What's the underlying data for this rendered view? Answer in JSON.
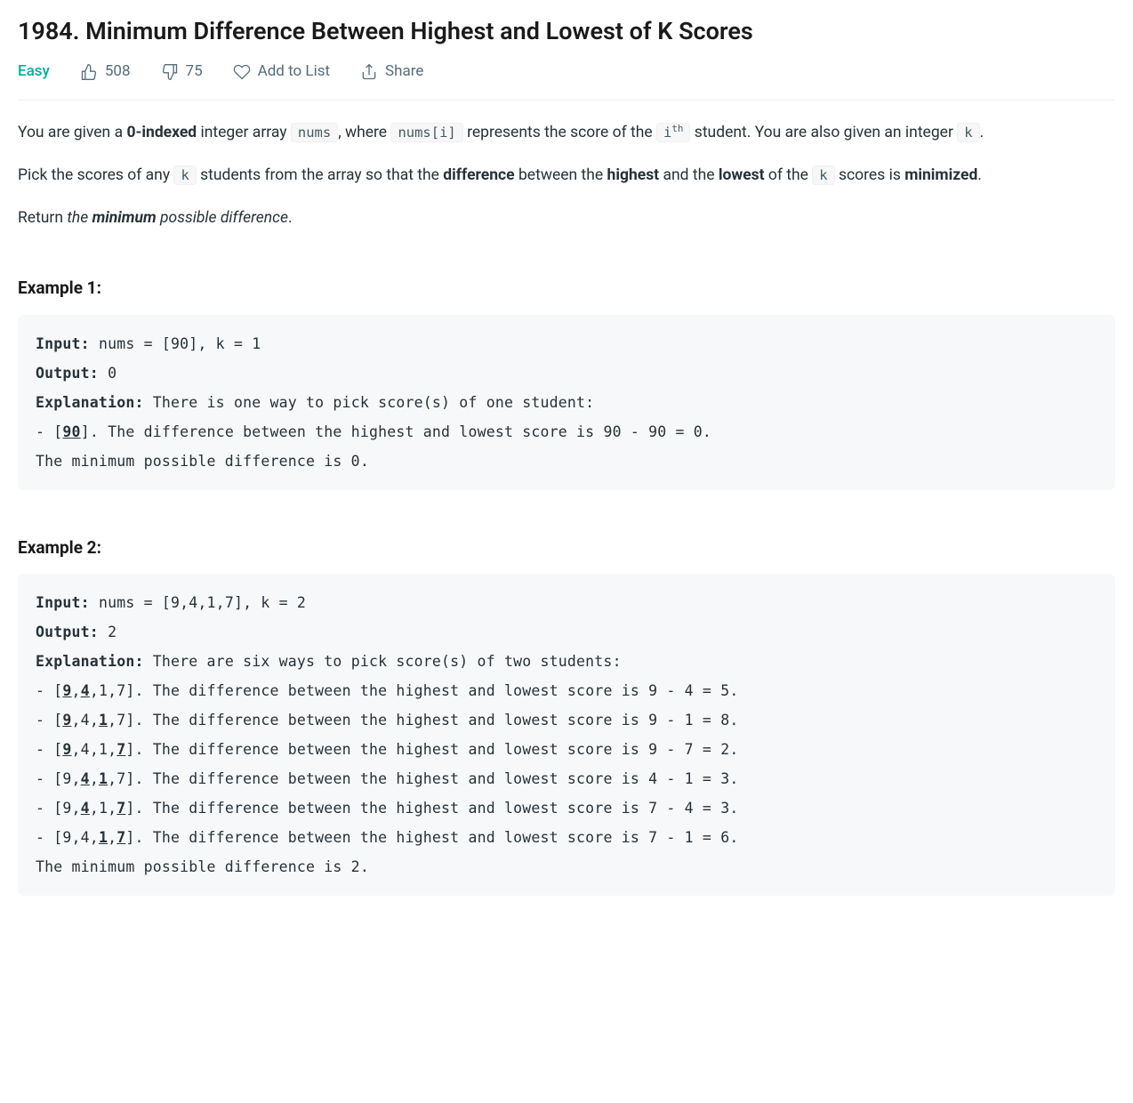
{
  "title": "1984. Minimum Difference Between Highest and Lowest of K Scores",
  "meta": {
    "difficulty": "Easy",
    "likes": "508",
    "dislikes": "75",
    "add_to_list": "Add to List",
    "share": "Share"
  },
  "desc": {
    "p1_a": "You are given a ",
    "p1_b": "0-indexed",
    "p1_c": " integer array ",
    "p1_code1": "nums",
    "p1_d": ", where ",
    "p1_code2": "nums[i]",
    "p1_e": " represents the score of the ",
    "p1_code3_base": "i",
    "p1_code3_sup": "th",
    "p1_f": " student. You are also given an integer ",
    "p1_code4": "k",
    "p1_g": ".",
    "p2_a": "Pick the scores of any ",
    "p2_code1": "k",
    "p2_b": " students from the array so that the ",
    "p2_c": "difference",
    "p2_d": " between the ",
    "p2_e": "highest",
    "p2_f": " and the ",
    "p2_g": "lowest",
    "p2_h": " of the ",
    "p2_code2": "k",
    "p2_i": " scores is ",
    "p2_j": "minimized",
    "p2_k": ".",
    "p3_a": "Return ",
    "p3_b": "the ",
    "p3_c": "minimum",
    "p3_d": " possible difference",
    "p3_e": "."
  },
  "example1_title": "Example 1:",
  "example1": {
    "input_label": "Input:",
    "input_val": " nums = [90], k = 1",
    "output_label": "Output:",
    "output_val": " 0",
    "expl_label": "Explanation:",
    "expl_intro": " There is one way to pick score(s) of one student:",
    "line1_a": "- [",
    "line1_u": "90",
    "line1_b": "]. The difference between the highest and lowest score is 90 - 90 = 0.",
    "final": "The minimum possible difference is 0."
  },
  "example2_title": "Example 2:",
  "example2": {
    "input_label": "Input:",
    "input_val": " nums = [9,4,1,7], k = 2",
    "output_label": "Output:",
    "output_val": " 2",
    "expl_label": "Explanation:",
    "expl_intro": " There are six ways to pick score(s) of two students:",
    "l1_a": "- [",
    "l1_u1": "9",
    "l1_b": ",",
    "l1_u2": "4",
    "l1_c": ",1,7]. The difference between the highest and lowest score is 9 - 4 = 5.",
    "l2_a": "- [",
    "l2_u1": "9",
    "l2_b": ",4,",
    "l2_u2": "1",
    "l2_c": ",7]. The difference between the highest and lowest score is 9 - 1 = 8.",
    "l3_a": "- [",
    "l3_u1": "9",
    "l3_b": ",4,1,",
    "l3_u2": "7",
    "l3_c": "]. The difference between the highest and lowest score is 9 - 7 = 2.",
    "l4_a": "- [9,",
    "l4_u1": "4",
    "l4_b": ",",
    "l4_u2": "1",
    "l4_c": ",7]. The difference between the highest and lowest score is 4 - 1 = 3.",
    "l5_a": "- [9,",
    "l5_u1": "4",
    "l5_b": ",1,",
    "l5_u2": "7",
    "l5_c": "]. The difference between the highest and lowest score is 7 - 4 = 3.",
    "l6_a": "- [9,4,",
    "l6_u1": "1",
    "l6_b": ",",
    "l6_u2": "7",
    "l6_c": "]. The difference between the highest and lowest score is 7 - 1 = 6.",
    "final": "The minimum possible difference is 2."
  }
}
